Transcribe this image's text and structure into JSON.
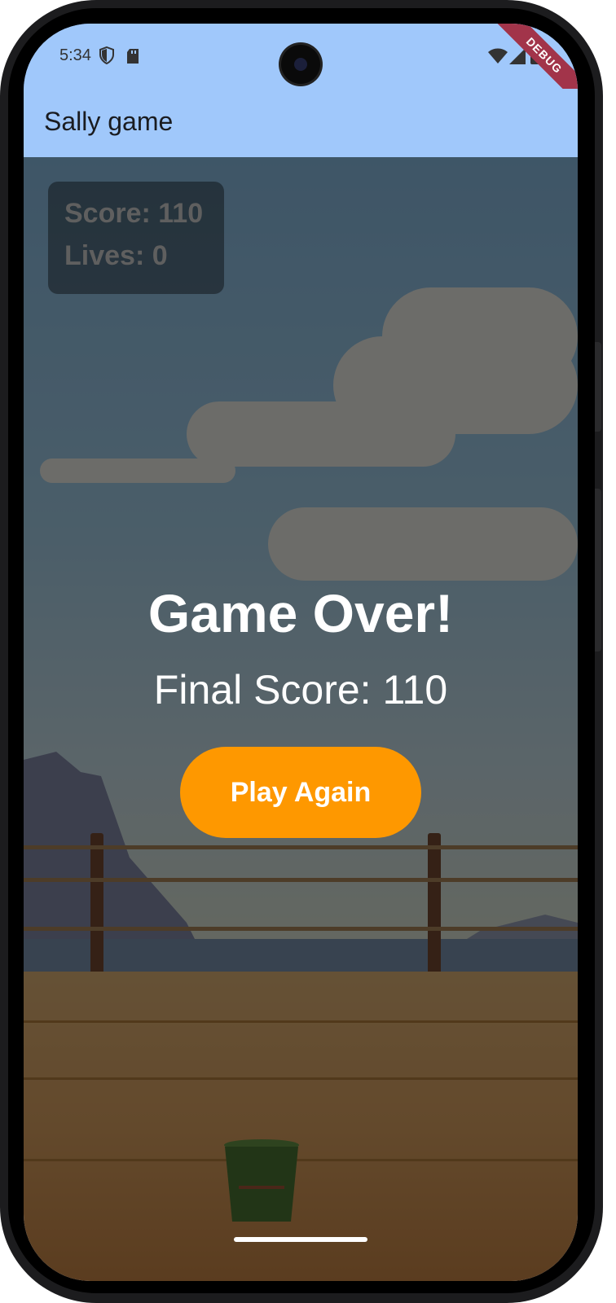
{
  "status_bar": {
    "time": "5:34",
    "icons": [
      "shield-icon",
      "sd-card-icon",
      "wifi-icon",
      "signal-icon",
      "battery-icon"
    ],
    "debug_banner": "DEBUG"
  },
  "app_bar": {
    "title": "Sally game"
  },
  "hud": {
    "score": "Score: 110",
    "lives": "Lives: 0"
  },
  "game_over": {
    "title": "Game Over!",
    "final_score": "Final Score: 110",
    "play_again_label": "Play Again"
  },
  "colors": {
    "app_bar": "#a0c8fb",
    "button": "#fe9800",
    "debug_ribbon": "#a2344a",
    "bucket": "#4f7a35"
  }
}
